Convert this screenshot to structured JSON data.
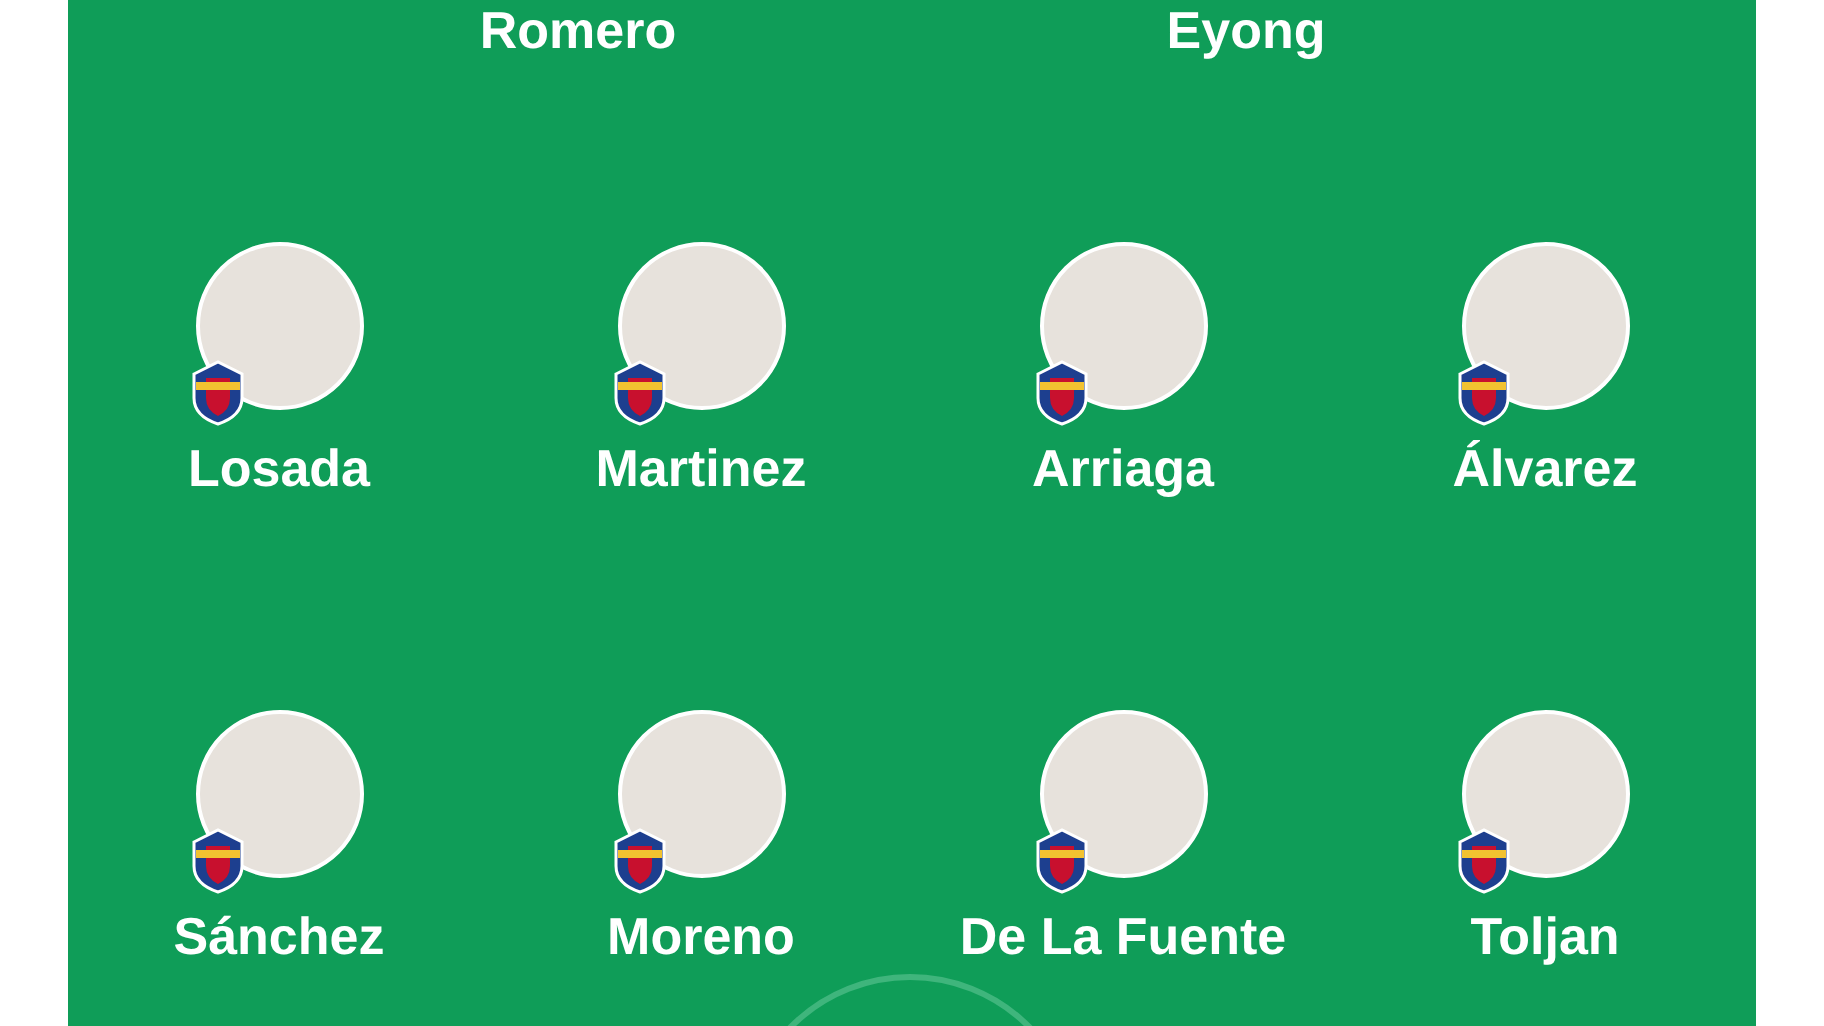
{
  "top_row": [
    {
      "name": "Romero"
    },
    {
      "name": "Eyong"
    }
  ],
  "rows": [
    [
      {
        "name": "Losada"
      },
      {
        "name": "Martinez"
      },
      {
        "name": "Arriaga"
      },
      {
        "name": "Álvarez"
      }
    ],
    [
      {
        "name": "Sánchez"
      },
      {
        "name": "Moreno"
      },
      {
        "name": "De La Fuente"
      },
      {
        "name": "Toljan"
      }
    ]
  ]
}
